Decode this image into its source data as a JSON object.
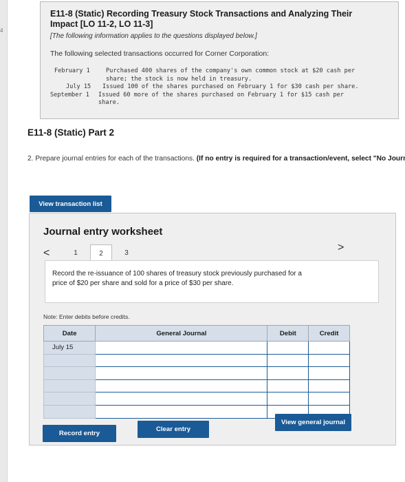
{
  "sidebar": {
    "page_number": "4"
  },
  "header": {
    "title": "E11-8 (Static) Recording Treasury Stock Transactions and Analyzing Their Impact [LO 11-2, LO 11-3]",
    "intro": "[The following information applies to the questions displayed below.]",
    "lead": "The following selected transactions occurred for Corner Corporation:"
  },
  "transactions": [
    {
      "date": "February 1",
      "desc_line1": "Purchased 400 shares of the company's own common stock at $20 cash per",
      "desc_line2": "share; the stock is now held in treasury."
    },
    {
      "date": "July 15",
      "desc_line1": "Issued 100 of the shares purchased on February 1 for $30 cash per share."
    },
    {
      "date": "September 1",
      "desc_line1": "Issued 60 more of the shares purchased on February 1 for $15 cash per",
      "desc_line2": "share."
    }
  ],
  "part": {
    "title": "E11-8 (Static) Part 2",
    "question_prefix": "2. Prepare journal entries for each of the transactions. ",
    "question_bold": "(If no entry is required for a transaction/event, select \"No Journal Entry Required\" in the first account field.)"
  },
  "buttons": {
    "view_transactions": "View transaction list",
    "record_entry": "Record entry",
    "clear_entry": "Clear entry",
    "view_general_journal": "View general journal"
  },
  "worksheet": {
    "title": "Journal entry worksheet",
    "prev_arrow": "<",
    "next_arrow": ">",
    "tabs": [
      "1",
      "2",
      "3"
    ],
    "active_tab": 1,
    "instruction": "Record the re-issuance of 100 shares of treasury stock previously purchased for a price of $20 per share and sold for a price of $30 per share.",
    "note": "Note: Enter debits before credits.",
    "columns": {
      "date": "Date",
      "account": "General Journal",
      "debit": "Debit",
      "credit": "Credit"
    },
    "rows": [
      {
        "date": "July 15",
        "account": "",
        "debit": "",
        "credit": ""
      },
      {
        "date": "",
        "account": "",
        "debit": "",
        "credit": ""
      },
      {
        "date": "",
        "account": "",
        "debit": "",
        "credit": ""
      },
      {
        "date": "",
        "account": "",
        "debit": "",
        "credit": ""
      },
      {
        "date": "",
        "account": "",
        "debit": "",
        "credit": ""
      },
      {
        "date": "",
        "account": "",
        "debit": "",
        "credit": ""
      }
    ]
  },
  "colors": {
    "button": "#1a5a96",
    "header_row": "#d6dfe9",
    "panel": "#efefef"
  }
}
